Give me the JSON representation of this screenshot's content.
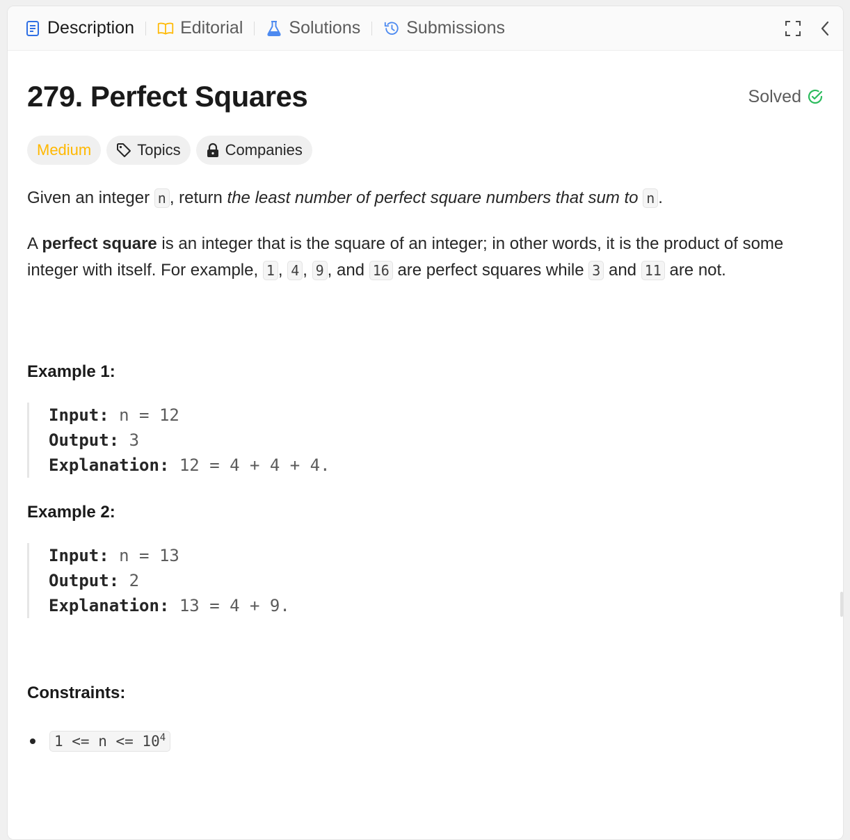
{
  "tabs": [
    {
      "label": "Description",
      "icon": "description-icon",
      "color": "#1a1a1a",
      "icon_color": "#2f6fe4"
    },
    {
      "label": "Editorial",
      "icon": "book-icon",
      "icon_color": "#ffb800"
    },
    {
      "label": "Solutions",
      "icon": "flask-icon",
      "icon_color": "#4d8af0"
    },
    {
      "label": "Submissions",
      "icon": "history-icon",
      "icon_color": "#4d8af0"
    }
  ],
  "tab_actions": [
    "fullscreen-icon",
    "collapse-chevron-icon"
  ],
  "problem": {
    "title": "279. Perfect Squares",
    "status": "Solved",
    "status_color": "#2cbb5d"
  },
  "tags": {
    "difficulty": "Medium",
    "difficulty_color": "#ffb800",
    "topics": "Topics",
    "companies": "Companies"
  },
  "description": {
    "intro_1": "Given an integer ",
    "intro_code_1": "n",
    "intro_2": ", return ",
    "intro_em": "the least number of perfect square numbers that sum to",
    "intro_3": " ",
    "intro_code_2": "n",
    "intro_4": ".",
    "def_1": "A ",
    "def_bold": "perfect square",
    "def_2": " is an integer that is the square of an integer; in other words, it is the product of some integer with itself. For example, ",
    "def_c1": "1",
    "def_s1": ", ",
    "def_c2": "4",
    "def_s2": ", ",
    "def_c3": "9",
    "def_s3": ", and ",
    "def_c4": "16",
    "def_3": " are perfect squares while ",
    "def_c5": "3",
    "def_4": " and ",
    "def_c6": "11",
    "def_5": " are not."
  },
  "examples": [
    {
      "title": "Example 1:",
      "input_label": "Input:",
      "input": "n = 12",
      "output_label": "Output:",
      "output": "3",
      "explanation_label": "Explanation:",
      "explanation": "12 = 4 + 4 + 4."
    },
    {
      "title": "Example 2:",
      "input_label": "Input:",
      "input": "n = 13",
      "output_label": "Output:",
      "output": "2",
      "explanation_label": "Explanation:",
      "explanation": "13 = 4 + 9."
    }
  ],
  "constraints": {
    "title": "Constraints:",
    "items": [
      {
        "text": "1 <= n <= 10",
        "sup": "4"
      }
    ]
  }
}
